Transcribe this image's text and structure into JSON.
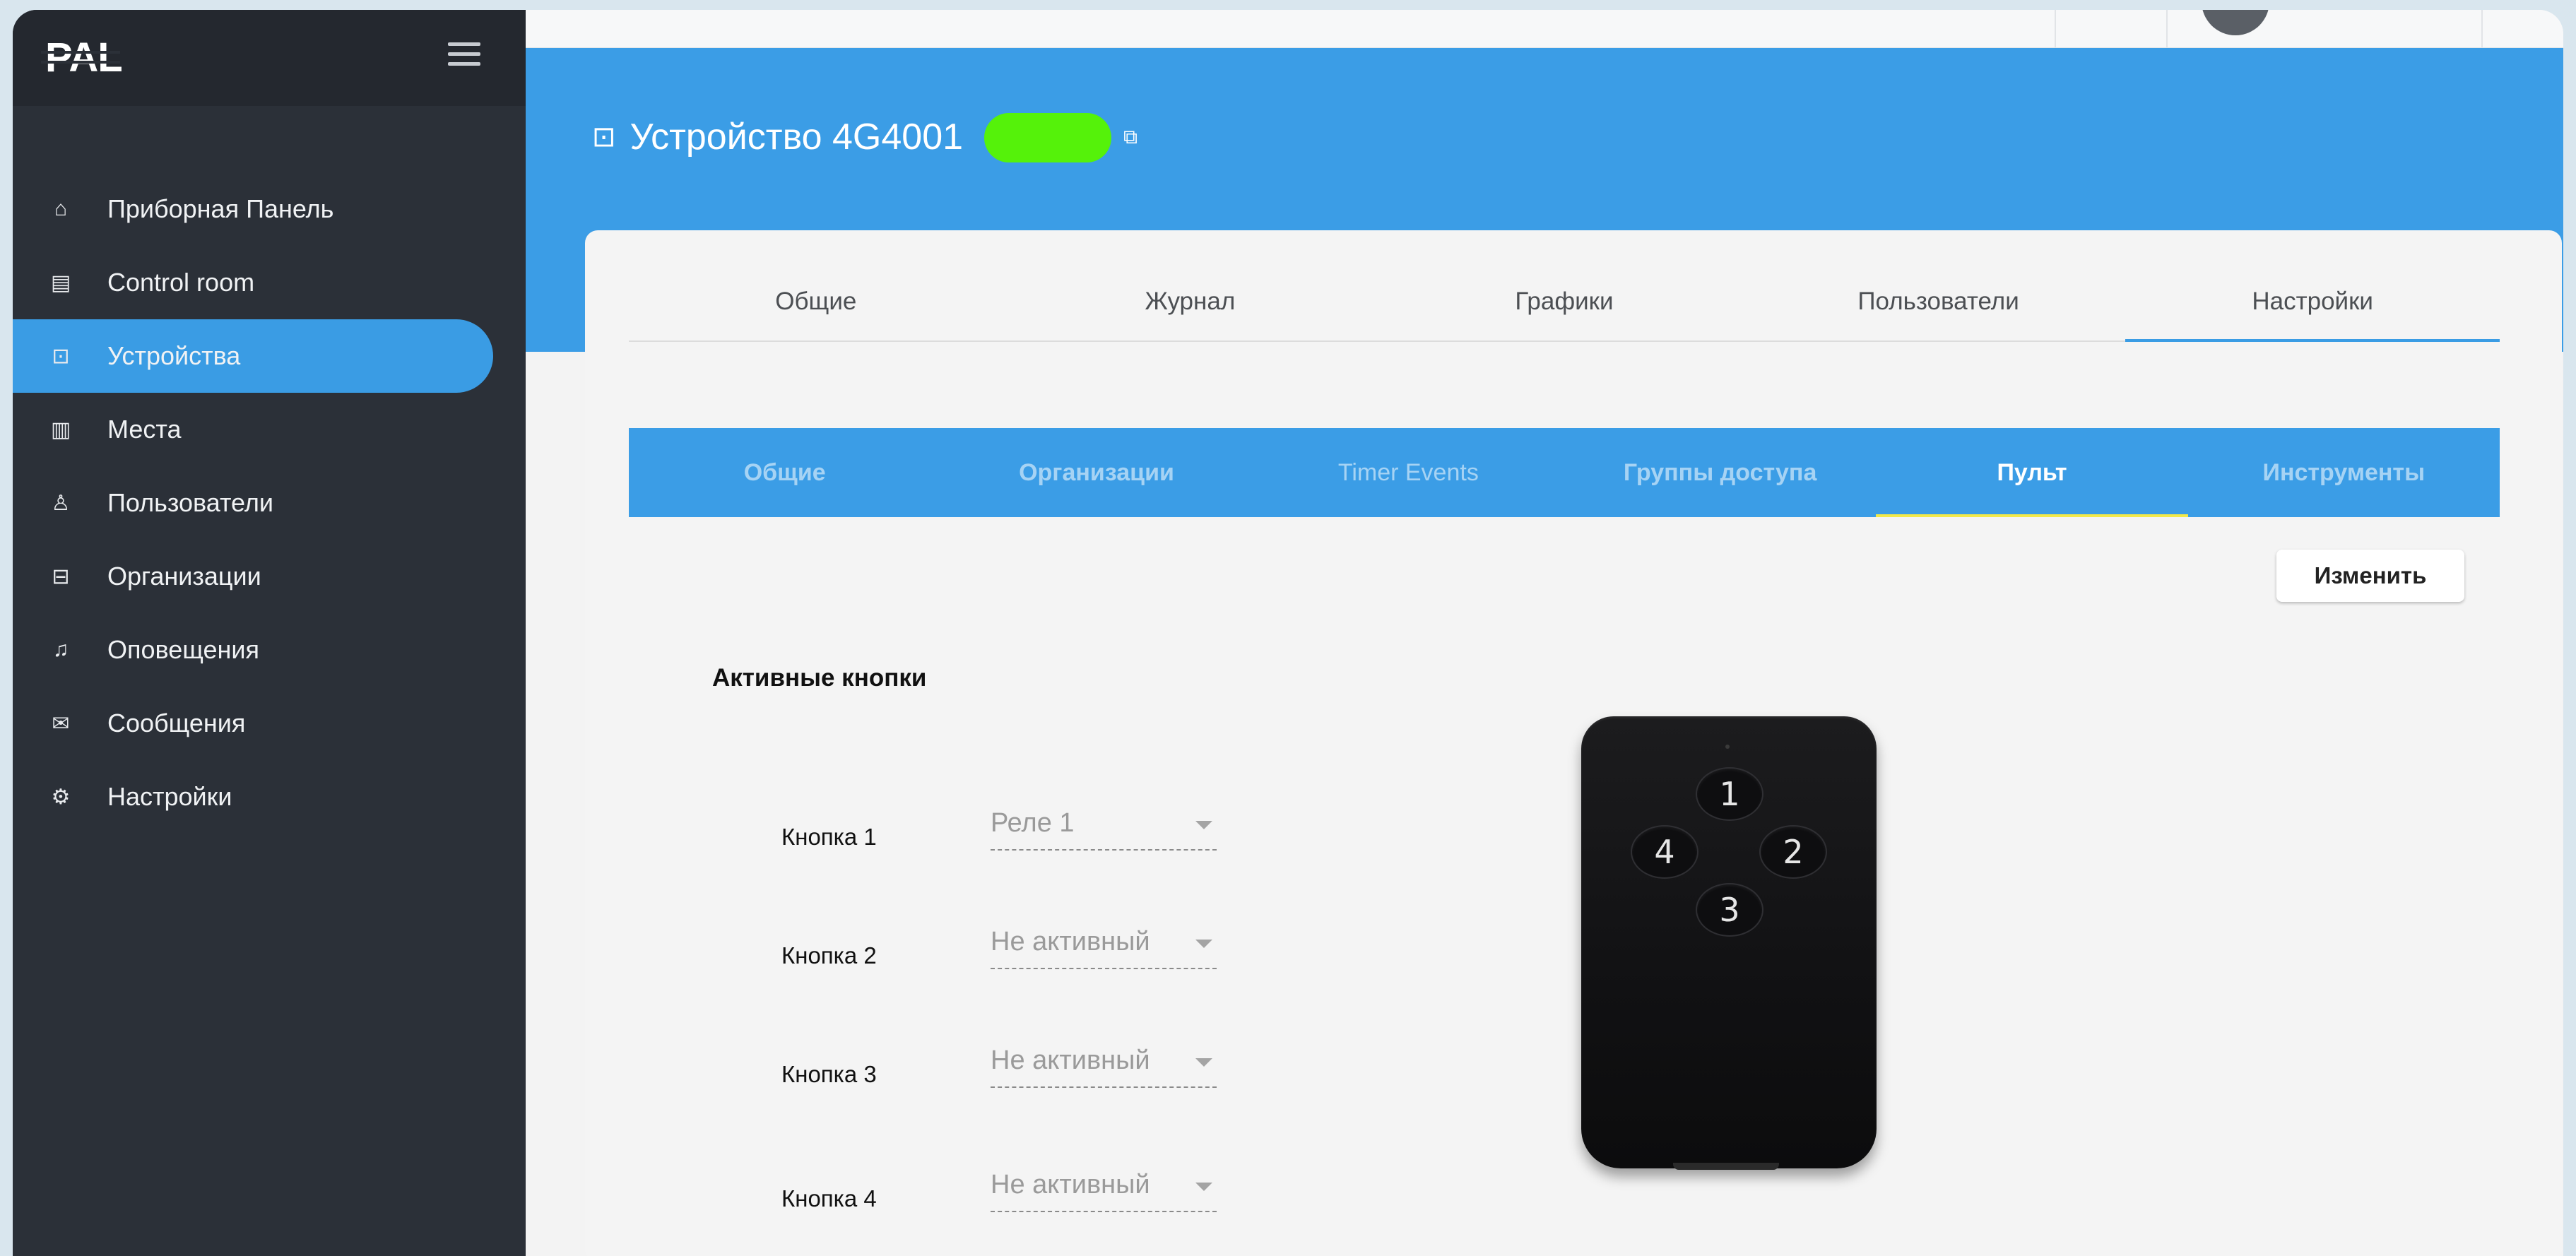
{
  "sidebar": {
    "logo": "PAL",
    "items": [
      {
        "label": "Приборная Панель",
        "icon": "home-icon",
        "glyph": "⌂",
        "active": false
      },
      {
        "label": "Control room",
        "icon": "building-icon",
        "glyph": "▤",
        "active": false
      },
      {
        "label": "Устройства",
        "icon": "router-icon",
        "glyph": "⊡",
        "active": true
      },
      {
        "label": "Места",
        "icon": "map-icon",
        "glyph": "▥",
        "active": false
      },
      {
        "label": "Пользователи",
        "icon": "user-icon",
        "glyph": "♙",
        "active": false
      },
      {
        "label": "Организации",
        "icon": "briefcase-icon",
        "glyph": "⊟",
        "active": false
      },
      {
        "label": "Оповещения",
        "icon": "bell-icon",
        "glyph": "♫",
        "active": false
      },
      {
        "label": "Сообщения",
        "icon": "mail-icon",
        "glyph": "✉",
        "active": false
      },
      {
        "label": "Настройки",
        "icon": "gear-icon",
        "glyph": "⚙",
        "active": false
      }
    ]
  },
  "header": {
    "device_title": "Устройство 4G4001"
  },
  "tabs": [
    {
      "label": "Общие",
      "active": false
    },
    {
      "label": "Журнал",
      "active": false
    },
    {
      "label": "Графики",
      "active": false
    },
    {
      "label": "Пользователи",
      "active": false
    },
    {
      "label": "Настройки",
      "active": true
    }
  ],
  "subtabs": [
    {
      "label": "Общие",
      "active": false
    },
    {
      "label": "Организации",
      "active": false
    },
    {
      "label": "Timer Events",
      "active": false
    },
    {
      "label": "Группы доступа",
      "active": false
    },
    {
      "label": "Пульт",
      "active": true
    },
    {
      "label": "Инструменты",
      "active": false
    }
  ],
  "edit_button": "Изменить",
  "section_title": "Активные кнопки",
  "buttons": [
    {
      "label": "Кнопка 1",
      "value": "Реле 1"
    },
    {
      "label": "Кнопка 2",
      "value": "Не активный"
    },
    {
      "label": "Кнопка 3",
      "value": "Не активный"
    },
    {
      "label": "Кнопка 4",
      "value": "Не активный"
    }
  ],
  "remote": {
    "keys": [
      "1",
      "2",
      "3",
      "4"
    ]
  },
  "colors": {
    "accent": "#3b9de6",
    "sidebar": "#2b3038",
    "active_underline": "#f2e94a",
    "redaction": "#55f20a"
  }
}
